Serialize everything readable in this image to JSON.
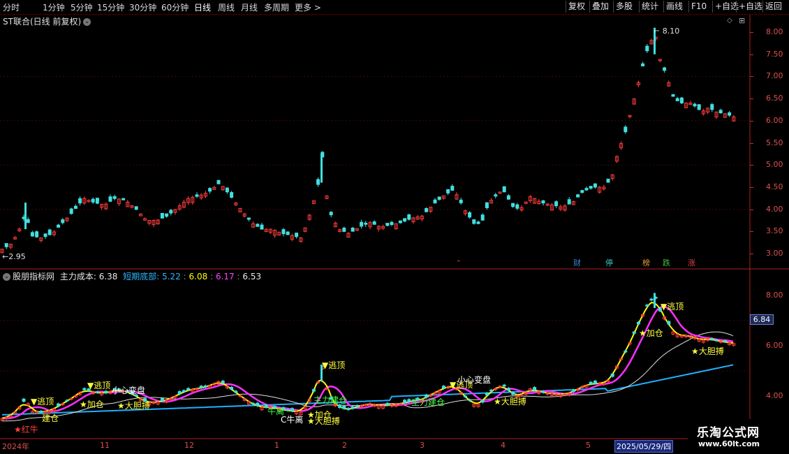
{
  "toolbar": {
    "periods": [
      "分时",
      "1分钟",
      "5分钟",
      "15分钟",
      "30分钟",
      "60分钟",
      "日线",
      "周线",
      "月线",
      "多周期",
      "更多"
    ],
    "active_period": "日线",
    "right_buttons": [
      "复权",
      "叠加",
      "多股",
      "统计",
      "画线",
      "F10",
      "+自选",
      "返回"
    ],
    "more_icon": "chevron-right-icon"
  },
  "main_chart": {
    "title": "ST联合(日线 前复权)",
    "high_label": "8.10",
    "low_label": "2.95",
    "y_ticks": [
      "8.00",
      "7.50",
      "7.00",
      "6.50",
      "6.00",
      "5.50",
      "5.00",
      "4.50",
      "4.00",
      "3.50",
      "3.00"
    ],
    "badges": [
      {
        "text": "财",
        "color": "#3a8ad8"
      },
      {
        "text": "停",
        "color": "#3ac8c8"
      },
      {
        "text": "榜",
        "color": "#e0a030"
      },
      {
        "text": "跌",
        "color": "#40c040"
      },
      {
        "text": "涨",
        "color": "#e04040"
      }
    ]
  },
  "indicator": {
    "name": "股朋指标网",
    "items": [
      {
        "label": "主力成本: 6.38",
        "color": "#e8e8e8"
      },
      {
        "label": "短期底部: 5.22",
        "color": "#30b8ff"
      },
      {
        "label": "6.08",
        "color": "#ffff00"
      },
      {
        "label": "6.17",
        "color": "#ff40ff"
      },
      {
        "label": "6.53",
        "color": "#e8e8e8"
      }
    ],
    "y_ticks": [
      "8.00",
      "6.00",
      "4.00"
    ],
    "current_value": "6.84",
    "annotations": [
      {
        "text": "▼逃顶",
        "color": "#ffff40"
      },
      {
        "text": "▼逃顶",
        "color": "#ffff40"
      },
      {
        "text": "▼逃顶",
        "color": "#ffff40"
      },
      {
        "text": "▼逃顶",
        "color": "#ffff40"
      },
      {
        "text": "▼逃顶",
        "color": "#ffff40"
      },
      {
        "text": "★加仓",
        "color": "#ffff40"
      },
      {
        "text": "★加仓",
        "color": "#ffff40"
      },
      {
        "text": "★加仓",
        "color": "#ffff40"
      },
      {
        "text": "★大胆搏",
        "color": "#ffff40"
      },
      {
        "text": "★大胆搏",
        "color": "#ffff40"
      },
      {
        "text": "★大胆搏",
        "color": "#ffff40"
      },
      {
        "text": "★大胆搏",
        "color": "#ffff40"
      },
      {
        "text": "★红牛",
        "color": "#ff4040"
      },
      {
        "text": "小心变盘",
        "color": "#ffffff"
      },
      {
        "text": "小心变盘",
        "color": "#ffffff"
      },
      {
        "text": "主力建仓",
        "color": "#40ff40"
      },
      {
        "text": "主力建仓",
        "color": "#40ff40"
      },
      {
        "text": "牛离",
        "color": "#40ff40"
      },
      {
        "text": "C牛离",
        "color": "#ffffff"
      },
      {
        "text": "建仓",
        "color": "#ffff40"
      }
    ]
  },
  "x_axis": {
    "labels": [
      "2024年",
      "11",
      "12",
      "1",
      "2",
      "3",
      "4",
      "5"
    ],
    "selected_date": "2025/05/29/四"
  },
  "watermark": {
    "line1": "乐淘公式网",
    "line2": "www.60lt.com"
  },
  "colors": {
    "up": "#ff3c3c",
    "down": "#40e0e0",
    "axis": "#c03030",
    "yellow_line": "#ffff00",
    "magenta_line": "#ff30ff",
    "white_line": "#e0e0e0",
    "blue_line": "#20b0ff"
  }
}
